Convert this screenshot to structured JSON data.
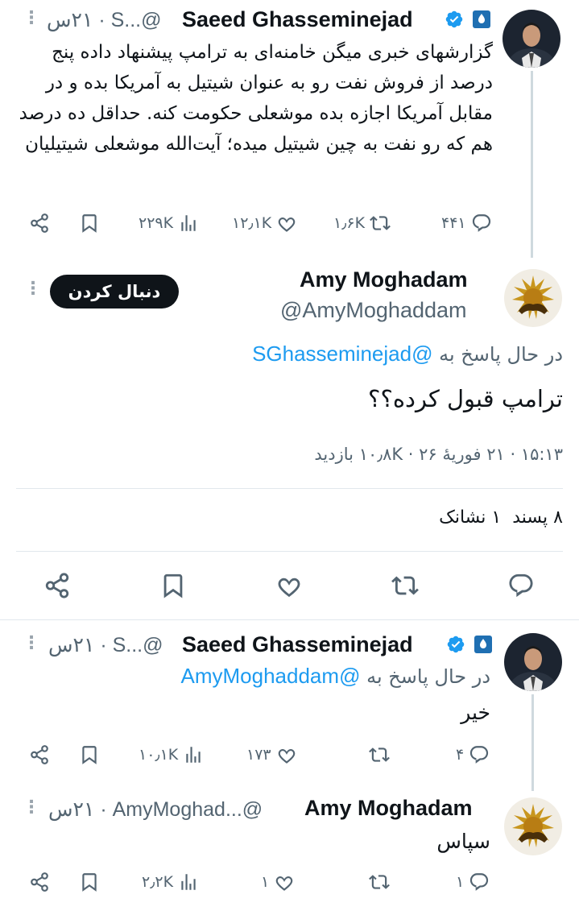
{
  "tweet1": {
    "name": "Saeed Ghasseminejad",
    "handle_time": "٢١س · S...@",
    "text": "گزارشهای خبری میگن خامنه‌ای به ترامپ پیشنهاد داده پنج درصد از فروش نفت رو به عنوان شیتیل به آمریکا بده و در مقابل آمریکا اجازه بده موشعلی حکومت کنه. حداقل ده درصد هم که رو نفت به چین شیتیل میده؛ آیت‌الله موشعلی شیتیلیان",
    "replies": "۴۴۱",
    "retweets": "۱٫۶K",
    "likes": "۱۲٫۱K",
    "views": "۲۲۹K"
  },
  "main": {
    "name": "Amy Moghadam",
    "handle": "@AmyMoghaddam",
    "follow_label": "دنبال کردن",
    "reply_prefix": "در حال پاسخ به",
    "reply_to": "@SGhasseminejad",
    "text": "ترامپ قبول کرده؟؟",
    "timestamp": "۱۵:۱۳ · ۲۱ فوریهٔ ۲۶ · ۱۰٫۸K بازدید",
    "stats": "۸ پسند  ۱ نشانک"
  },
  "tweet3": {
    "name": "Saeed Ghasseminejad",
    "handle_time": "٢١س · S...@",
    "reply_prefix": "در حال پاسخ به",
    "reply_to": "@AmyMoghaddam",
    "text": "خیر",
    "replies": "۴",
    "likes": "۱۷۳",
    "views": "۱۰٫۱K"
  },
  "tweet4": {
    "name": "Amy Moghadam",
    "handle_time": "٢١س · AmyMoghad...@",
    "text": "سپاس",
    "replies": "۱",
    "likes": "۱",
    "views": "۲٫۲K"
  },
  "colors": {
    "accent": "#1d9bf0",
    "text": "#0f1419",
    "muted": "#536471",
    "divider": "#e1e8ed",
    "thread": "#cfd9de"
  }
}
